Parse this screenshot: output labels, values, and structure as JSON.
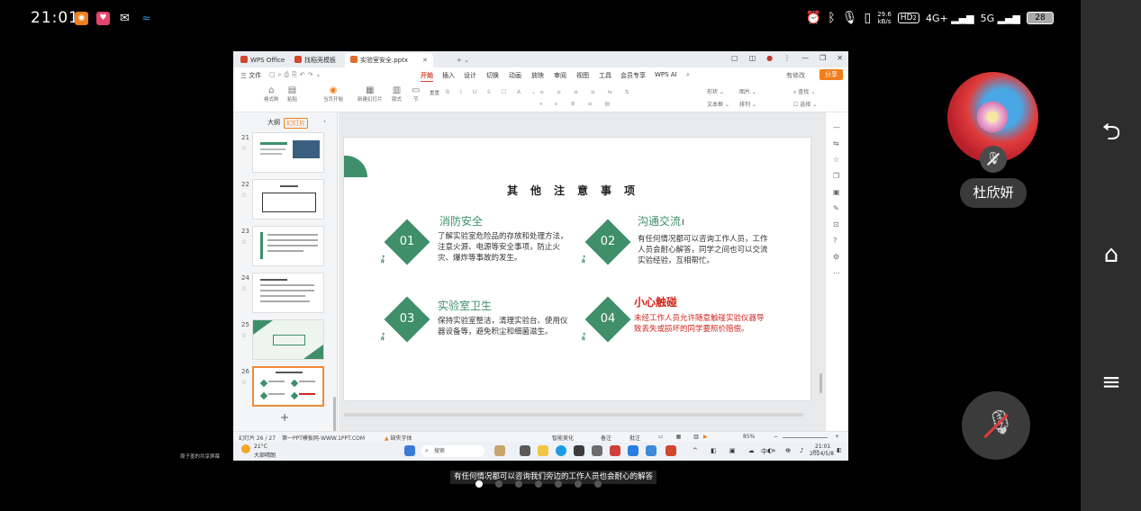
{
  "status_bar": {
    "time": "21:01",
    "net_speed_value": "29.6",
    "net_speed_unit": "kB/s",
    "hd": "HD",
    "hd_sub": "2",
    "signal1": "4G+",
    "signal2": "5G",
    "battery": "28"
  },
  "wps": {
    "tabs": [
      {
        "label": "WPS Office",
        "color": "#d2462e"
      },
      {
        "label": "找稻壳模板",
        "color": "#d2462e"
      },
      {
        "label": "实验室安全.pptx",
        "color": "#e06a2c"
      }
    ],
    "menu": {
      "file": "三 文件",
      "items": [
        "开始",
        "插入",
        "设计",
        "切换",
        "动画",
        "放映",
        "审阅",
        "视图",
        "工具",
        "会员专享",
        "WPS AI"
      ],
      "active": "开始",
      "modify": "有修改",
      "share": "分享"
    },
    "ribbon": {
      "format_brush": "格式刷",
      "paste": "粘贴",
      "play": "当页开始",
      "new_slide": "新建幻灯片",
      "layout": "版式",
      "section": "节",
      "reset": "重置",
      "shape": "形状",
      "image": "图片",
      "textbox": "文本框",
      "arrange": "排列",
      "find": "查找",
      "select": "选择"
    },
    "left_pane": {
      "tab_outline": "大纲",
      "tab_slides": "幻灯片",
      "thumb_numbers": [
        "21",
        "22",
        "23",
        "24",
        "25",
        "26"
      ],
      "add": "+"
    },
    "slide": {
      "title": "其他注意事项",
      "items": [
        {
          "num": "01",
          "title": "消防安全",
          "text": "了解实验室危险品的存放和处理方法，注意火源、电源等安全事项，防止火灾、爆炸等事故的发生。"
        },
        {
          "num": "02",
          "title": "沟通交流",
          "text": "有任何情况都可以咨询工作人员，工作人员会耐心解答，同学之间也可以交流实验经验，互相帮忙。"
        },
        {
          "num": "03",
          "title": "实验室卫生",
          "text": "保持实验室整洁，清理实验台、使用仪器设备等，避免积尘和细菌滋生。"
        },
        {
          "num": "04",
          "title": "小心触碰",
          "text": "未经工作人员允许随意触碰实验仪器导致丢失或损坏的同学要照价赔偿。"
        }
      ]
    },
    "status_line": {
      "slide_count": "幻灯片 26 / 27",
      "theme": "第一PPT模板网-WWW.1PPT.COM",
      "missing_font": "缺失字体",
      "smart": "智能美化",
      "notes": "备注",
      "comment": "批注",
      "zoom": "85%"
    }
  },
  "taskbar": {
    "temp": "21°C",
    "weather": "大部晴朗",
    "search": "搜索",
    "ime": "中",
    "time": "21:01",
    "date": "2024/5/8"
  },
  "sharer_label": "周子墨的共享屏幕",
  "caption": "有任何情况都可以咨询我们旁边的工作人员也会耐心的解答",
  "participant": {
    "name": "杜欣妍"
  },
  "colors": {
    "accent_green": "#3e8f6a",
    "warning_red": "#d0261d",
    "wps_orange": "#f07e1b"
  }
}
